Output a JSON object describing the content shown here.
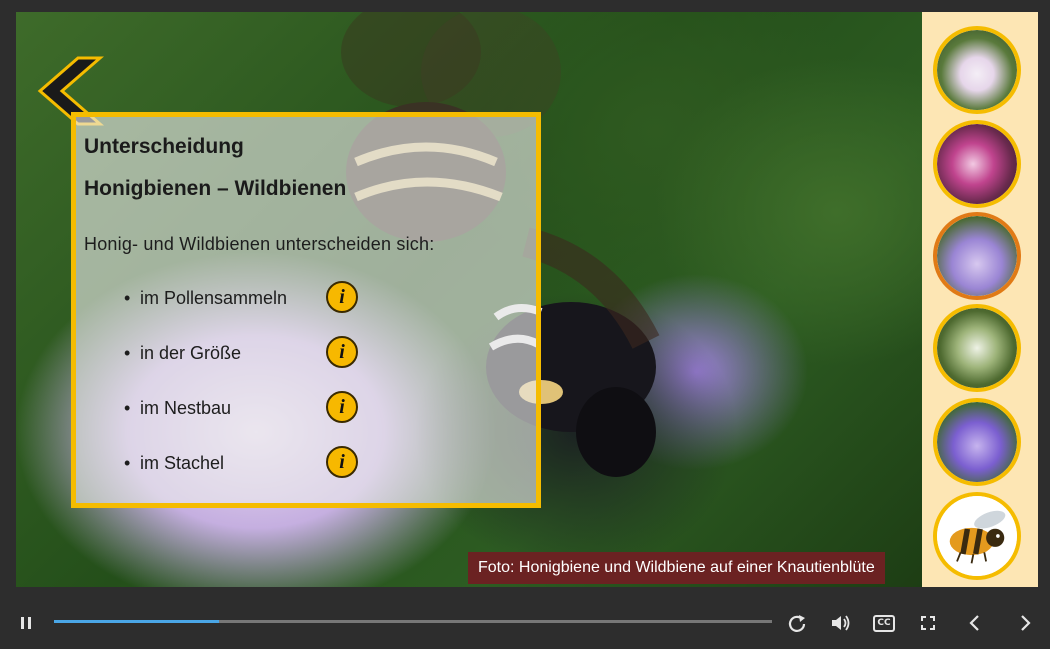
{
  "panel": {
    "title_line1": "Unterscheidung",
    "title_line2": "Honigbienen – Wildbienen",
    "intro": "Honig- und Wildbienen unterscheiden sich:",
    "bullets": [
      {
        "label": "im Pollensammeln",
        "icon": "info-icon"
      },
      {
        "label": "in der Größe",
        "icon": "info-icon"
      },
      {
        "label": "im Nestbau",
        "icon": "info-icon"
      },
      {
        "label": "im Stachel",
        "icon": "info-icon"
      }
    ],
    "info_glyph": "i"
  },
  "caption": "Foto: Honigbiene und Wildbiene auf einer Knautienblüte",
  "navigation": {
    "back_icon": "chevron-left-icon",
    "thumbnails": [
      {
        "name": "thumb-bee-on-white-flower",
        "active": false
      },
      {
        "name": "thumb-bee-on-pink-flower",
        "active": false
      },
      {
        "name": "thumb-bees-on-scabious",
        "active": true
      },
      {
        "name": "thumb-bee-on-white-blossoms",
        "active": false
      },
      {
        "name": "thumb-bee-on-purple-flower",
        "active": false
      },
      {
        "name": "thumb-bee-illustration",
        "active": false
      }
    ]
  },
  "player": {
    "progress": 0.23,
    "icons": [
      "pause-icon",
      "replay-icon",
      "volume-icon",
      "cc-icon",
      "fullscreen-icon",
      "prev-icon",
      "next-icon"
    ],
    "cc_label": "CC"
  },
  "colors": {
    "accent": "#f5bc00",
    "caption_bg": "#6b2222",
    "sidebar_bg": "#fde6b4",
    "progress_fill": "#4aa6e6",
    "active_thumb": "#e07a16"
  }
}
